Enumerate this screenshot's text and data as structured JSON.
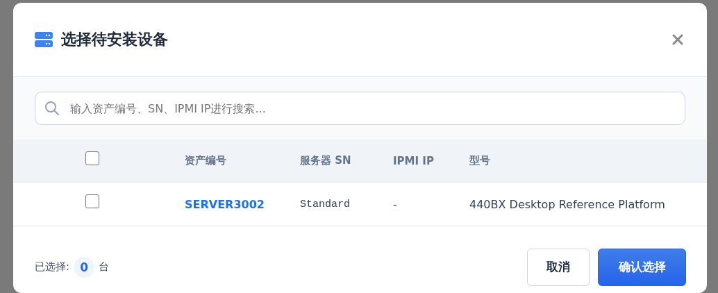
{
  "dialog": {
    "title": "选择待安装设备"
  },
  "search": {
    "placeholder": "输入资产编号、SN、IPMI IP进行搜索..."
  },
  "table": {
    "select_all": {
      "checked": false
    },
    "columns": [
      "资产编号",
      "服务器 SN",
      "IPMI IP",
      "型号"
    ],
    "rows": [
      {
        "checked": false,
        "asset_no": "SERVER3002",
        "sn": "Standard",
        "ipmi_ip": "-",
        "model": "440BX Desktop Reference Platform"
      }
    ]
  },
  "footer": {
    "selected_label": "已选择:",
    "selected_count": "0",
    "unit": "台"
  },
  "buttons": [
    {
      "kind": "secondary",
      "label": "取消"
    },
    {
      "kind": "primary",
      "label": "确认选择"
    }
  ]
}
